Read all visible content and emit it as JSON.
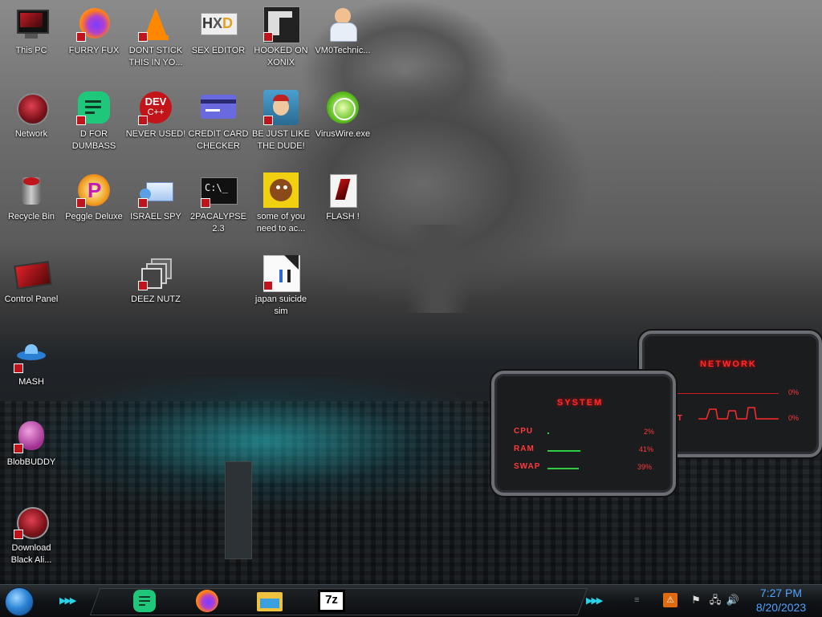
{
  "desktop": {
    "icons": [
      {
        "label": "This PC"
      },
      {
        "label": "FURRY FUX"
      },
      {
        "label": "DONT STICK THIS IN YO..."
      },
      {
        "label": "SEX EDITOR"
      },
      {
        "label": "HOOKED ON XONIX"
      },
      {
        "label": "VM0Technic..."
      },
      {
        "label": "Network"
      },
      {
        "label": "D FOR DUMBASS"
      },
      {
        "label": "NEVER USED!"
      },
      {
        "label": "CREDIT CARD CHECKER"
      },
      {
        "label": "BE JUST LIKE THE DUDE!"
      },
      {
        "label": "VirusWire.exe"
      },
      {
        "label": "Recycle Bin"
      },
      {
        "label": "Peggle Deluxe"
      },
      {
        "label": "ISRAEL SPY"
      },
      {
        "label": "2PACALYPSE 2.3"
      },
      {
        "label": "some of you need to ac..."
      },
      {
        "label": "FLASH !"
      },
      {
        "label": "Control Panel"
      },
      {
        "label": "DEEZ NUTZ"
      },
      {
        "label": "japan suicide sim"
      },
      {
        "label": "MASH"
      },
      {
        "label": "BlobBUDDY"
      },
      {
        "label": "Download Black Ali..."
      }
    ]
  },
  "gadgets": {
    "system": {
      "title": "SYSTEM",
      "rows": [
        {
          "label": "CPU",
          "value": "2%",
          "fraction": 0.02
        },
        {
          "label": "RAM",
          "value": "41%",
          "fraction": 0.41
        },
        {
          "label": "SWAP",
          "value": "39%",
          "fraction": 0.39
        }
      ]
    },
    "network": {
      "title": "NETWORK",
      "rows": [
        {
          "label": "",
          "value": "0%"
        },
        {
          "label": "IT",
          "value": "0%"
        }
      ]
    }
  },
  "taskbar": {
    "pinned": [
      {
        "icon": "notes-app-icon"
      },
      {
        "icon": "firefox-icon"
      },
      {
        "icon": "file-explorer-icon"
      },
      {
        "icon": "7zip-icon",
        "text": "7z"
      }
    ],
    "clock": {
      "time": "7:27 PM",
      "date": "8/20/2023"
    }
  },
  "colors": {
    "gadget_red": "#ff2a2a",
    "city_glow": "#28c8d2",
    "clock_blue": "#4ea3ff"
  }
}
